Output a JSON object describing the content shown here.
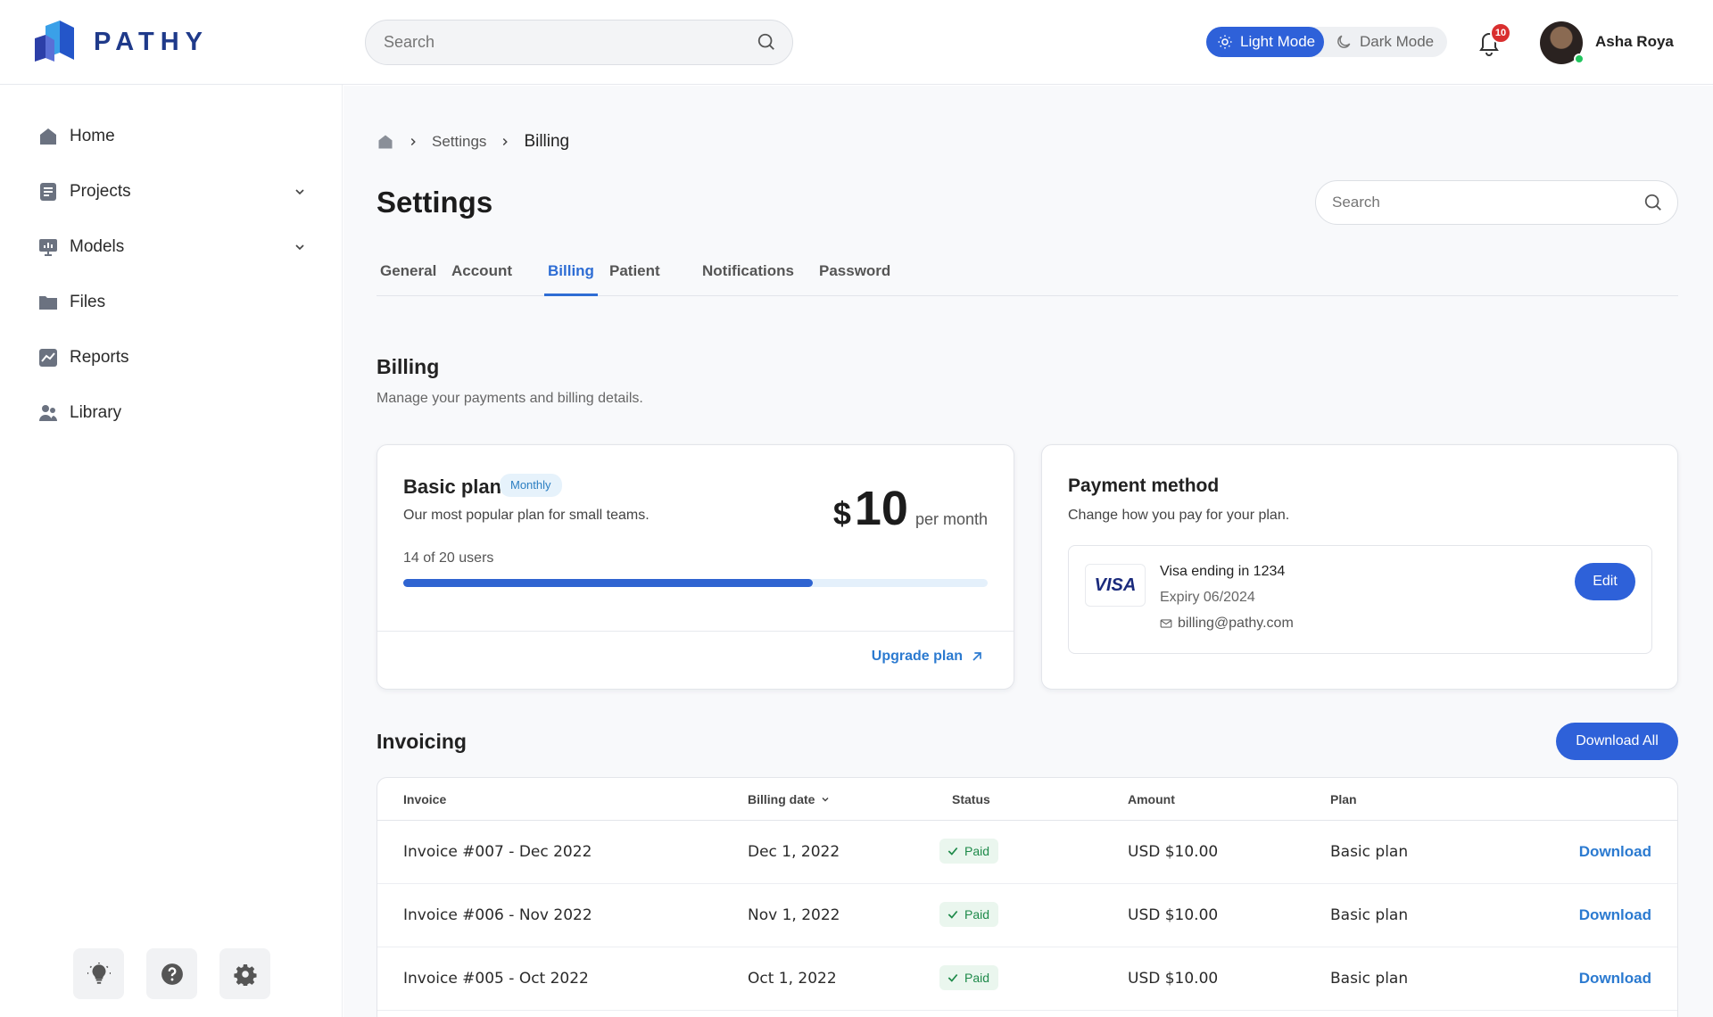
{
  "app": {
    "brand": "PATHY",
    "search_placeholder": "Search"
  },
  "modes": {
    "light": "Light Mode",
    "dark": "Dark Mode"
  },
  "notifications": {
    "count": "10"
  },
  "user": {
    "name": "Asha Roya"
  },
  "sidebar": {
    "items": [
      {
        "label": "Home",
        "icon": "home-icon"
      },
      {
        "label": "Projects",
        "icon": "document-icon",
        "expandable": true
      },
      {
        "label": "Models",
        "icon": "presentation-icon",
        "expandable": true
      },
      {
        "label": "Files",
        "icon": "folder-icon"
      },
      {
        "label": "Reports",
        "icon": "chart-icon"
      },
      {
        "label": "Library",
        "icon": "users-icon"
      }
    ],
    "tools": [
      "lightbulb-icon",
      "help-icon",
      "gear-icon"
    ]
  },
  "breadcrumb": {
    "items": [
      "Settings",
      "Billing"
    ]
  },
  "page": {
    "title": "Settings",
    "search_placeholder": "Search"
  },
  "tabs": [
    "General",
    "Account",
    "Billing",
    "Patient",
    "Notifications",
    "Password"
  ],
  "active_tab": "Billing",
  "billing": {
    "title": "Billing",
    "subtitle": "Manage your payments and billing details."
  },
  "plan": {
    "name": "Basic plan",
    "badge": "Monthly",
    "description": "Our most popular plan for small teams.",
    "currency": "$",
    "price": "10",
    "period": "per month",
    "users_label": "14 of 20 users",
    "users_used": 14,
    "users_total": 20,
    "upgrade_label": "Upgrade plan"
  },
  "payment": {
    "title": "Payment method",
    "subtitle": "Change how you pay for your plan.",
    "card_brand": "VISA",
    "ending": "Visa ending in 1234",
    "expiry": "Expiry 06/2024",
    "email": "billing@pathy.com",
    "edit_label": "Edit"
  },
  "invoicing": {
    "title": "Invoicing",
    "download_all_label": "Download All",
    "columns": [
      "Invoice",
      "Billing date",
      "Status",
      "Amount",
      "Plan"
    ],
    "rows": [
      {
        "invoice": "Invoice #007 - Dec 2022",
        "date": "Dec 1, 2022",
        "status": "Paid",
        "amount": "USD $10.00",
        "plan": "Basic plan",
        "action": "Download"
      },
      {
        "invoice": "Invoice #006 - Nov 2022",
        "date": "Nov 1, 2022",
        "status": "Paid",
        "amount": "USD $10.00",
        "plan": "Basic plan",
        "action": "Download"
      },
      {
        "invoice": "Invoice #005 - Oct 2022",
        "date": "Oct 1, 2022",
        "status": "Paid",
        "amount": "USD $10.00",
        "plan": "Basic plan",
        "action": "Download"
      }
    ]
  },
  "colors": {
    "accent": "#2e61d9",
    "link": "#2b7ad0",
    "paid_bg": "#eaf6ee",
    "paid_text": "#1e8a4a",
    "badge_red": "#d92f2f"
  }
}
